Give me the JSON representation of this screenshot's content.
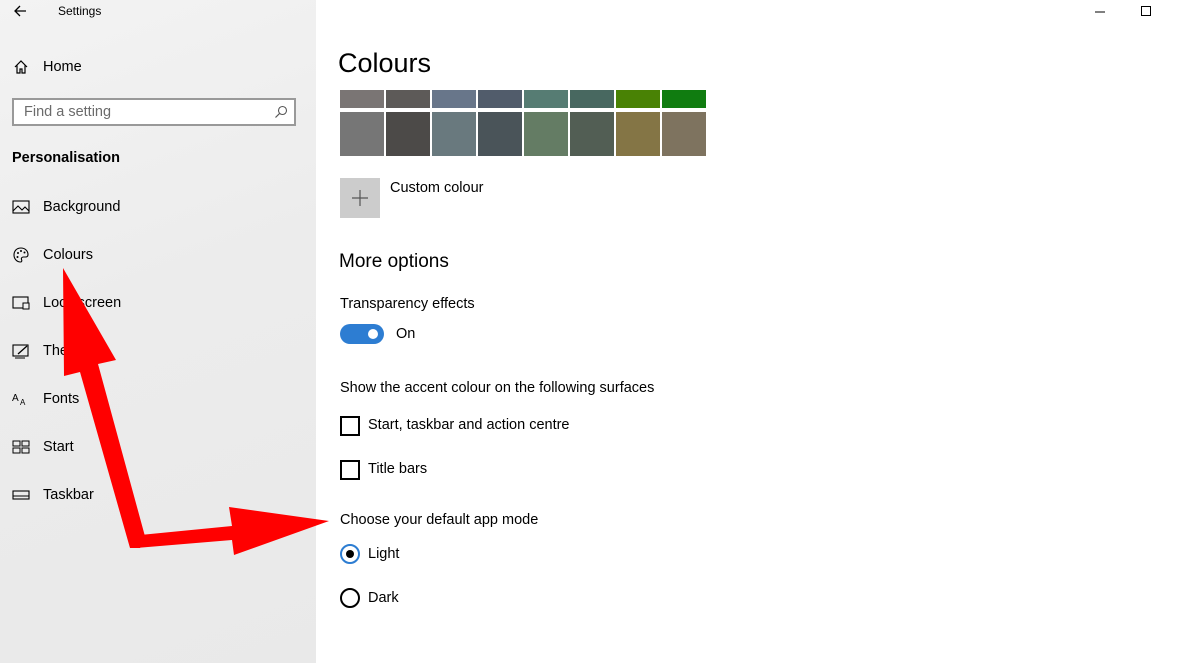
{
  "app": {
    "title": "Settings"
  },
  "sidebar": {
    "home_label": "Home",
    "search_placeholder": "Find a setting",
    "section_title": "Personalisation",
    "items": [
      {
        "label": "Background",
        "icon": "picture-icon"
      },
      {
        "label": "Colours",
        "icon": "palette-icon"
      },
      {
        "label": "Lock screen",
        "icon": "lock-screen-icon"
      },
      {
        "label": "Themes",
        "icon": "themes-icon"
      },
      {
        "label": "Fonts",
        "icon": "fonts-icon"
      },
      {
        "label": "Start",
        "icon": "start-icon"
      },
      {
        "label": "Taskbar",
        "icon": "taskbar-icon"
      }
    ]
  },
  "main": {
    "title": "Colours",
    "swatches_row1": [
      "#7a7574",
      "#5d5a58",
      "#68768a",
      "#515c6b",
      "#567c73",
      "#486860",
      "#498205",
      "#107c10"
    ],
    "swatches_row2": [
      "#767676",
      "#4c4a48",
      "#69797e",
      "#4a5459",
      "#647c64",
      "#525e54",
      "#847545",
      "#7e735f"
    ],
    "custom_colour_label": "Custom colour",
    "more_options_title": "More options",
    "transparency_label": "Transparency effects",
    "transparency_state": "On",
    "accent_surfaces_label": "Show the accent colour on the following surfaces",
    "checkbox_start_label": "Start, taskbar and action centre",
    "checkbox_titlebars_label": "Title bars",
    "app_mode_label": "Choose your default app mode",
    "mode_light_label": "Light",
    "mode_dark_label": "Dark"
  },
  "colors": {
    "accent": "#2d7dd2",
    "annotation_arrow": "#ff0000"
  }
}
